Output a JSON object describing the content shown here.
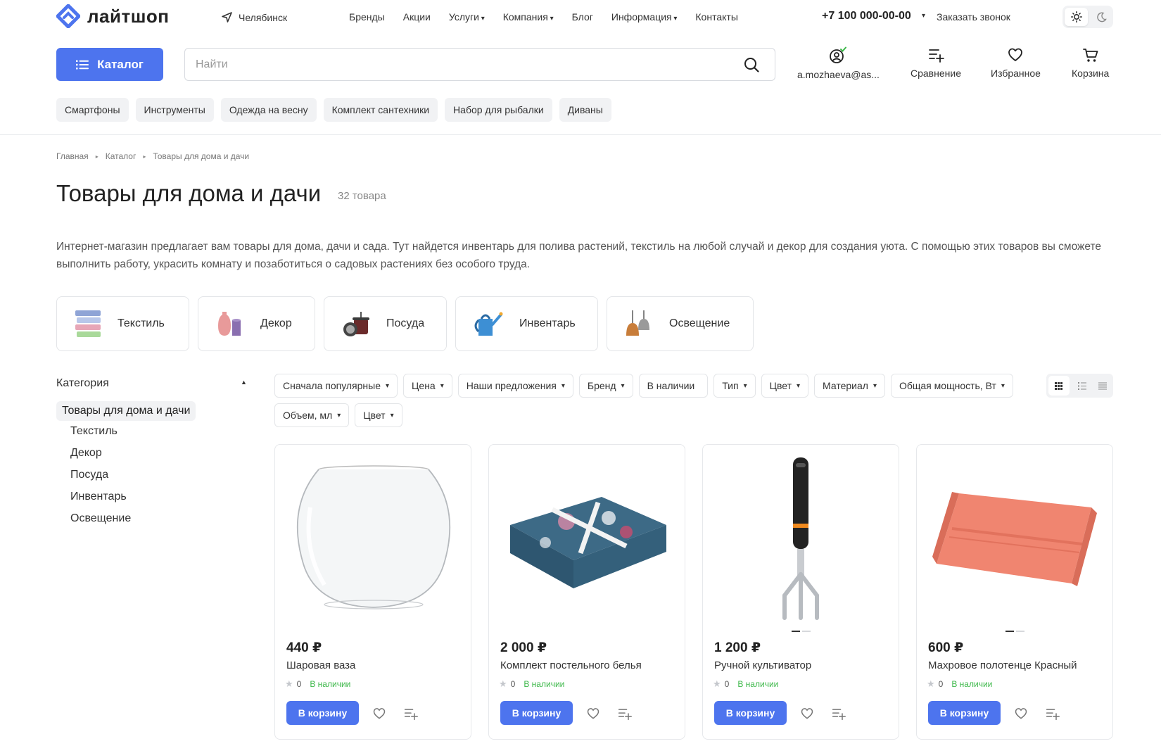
{
  "brand": {
    "name": "лайтшоп",
    "accent": "#4d74ee"
  },
  "header": {
    "city": "Челябинск",
    "nav": [
      {
        "label": "Бренды",
        "dropdown": false
      },
      {
        "label": "Акции",
        "dropdown": false
      },
      {
        "label": "Услуги",
        "dropdown": true
      },
      {
        "label": "Компания",
        "dropdown": true
      },
      {
        "label": "Блог",
        "dropdown": false
      },
      {
        "label": "Информация",
        "dropdown": true
      },
      {
        "label": "Контакты",
        "dropdown": false
      }
    ],
    "phone": "+7 100 000-00-00",
    "callback": "Заказать звонок",
    "catalog_label": "Каталог",
    "search_placeholder": "Найти",
    "account": "a.mozhaeva@as...",
    "compare": "Сравнение",
    "favorites": "Избранное",
    "cart": "Корзина"
  },
  "quick_tags": [
    "Смартфоны",
    "Инструменты",
    "Одежда на весну",
    "Комплект сантехники",
    "Набор для рыбалки",
    "Диваны"
  ],
  "breadcrumb": [
    "Главная",
    "Каталог",
    "Товары для дома и дачи"
  ],
  "page": {
    "title": "Товары для дома и дачи",
    "count": "32 товара",
    "description": "Интернет-магазин предлагает вам товары для дома, дачи и сада. Тут найдется инвентарь для полива растений, текстиль на любой случай и декор для создания уюта. С помощью этих товаров вы сможете выполнить работу, украсить комнату и позаботиться о садовых растениях без особого труда."
  },
  "category_tiles": [
    {
      "label": "Текстиль",
      "icon": "towels-icon"
    },
    {
      "label": "Декор",
      "icon": "vases-icon"
    },
    {
      "label": "Посуда",
      "icon": "cookware-icon"
    },
    {
      "label": "Инвентарь",
      "icon": "watering-can-icon"
    },
    {
      "label": "Освещение",
      "icon": "pendant-lamps-icon"
    }
  ],
  "sidebar": {
    "title": "Категория",
    "active": "Товары для дома и дачи",
    "items": [
      "Текстиль",
      "Декор",
      "Посуда",
      "Инвентарь",
      "Освещение"
    ]
  },
  "filters": [
    {
      "label": "Сначала популярные",
      "dropdown": true
    },
    {
      "label": "Цена",
      "dropdown": true
    },
    {
      "label": "Наши предложения",
      "dropdown": true
    },
    {
      "label": "Бренд",
      "dropdown": true
    },
    {
      "label": "В наличии",
      "dropdown": false
    },
    {
      "label": "Тип",
      "dropdown": true
    },
    {
      "label": "Цвет",
      "dropdown": true
    },
    {
      "label": "Материал",
      "dropdown": true
    },
    {
      "label": "Общая мощность, Вт",
      "dropdown": true
    },
    {
      "label": "Объем, мл",
      "dropdown": true
    },
    {
      "label": "Цвет",
      "dropdown": true
    }
  ],
  "products": [
    {
      "price": "440 ₽",
      "name": "Шаровая ваза",
      "rating": "0",
      "stock": "В наличии",
      "button": "В корзину",
      "image": "glass-vase",
      "gallery_dots": false
    },
    {
      "price": "2 000 ₽",
      "name": "Комплект постельного белья",
      "rating": "0",
      "stock": "В наличии",
      "button": "В корзину",
      "image": "bedding-set",
      "gallery_dots": false
    },
    {
      "price": "1 200 ₽",
      "name": "Ручной культиватор",
      "rating": "0",
      "stock": "В наличии",
      "button": "В корзину",
      "image": "hand-cultivator",
      "gallery_dots": true
    },
    {
      "price": "600 ₽",
      "name": "Махровое полотенце Красный",
      "rating": "0",
      "stock": "В наличии",
      "button": "В корзину",
      "image": "terry-towel",
      "gallery_dots": true
    }
  ]
}
